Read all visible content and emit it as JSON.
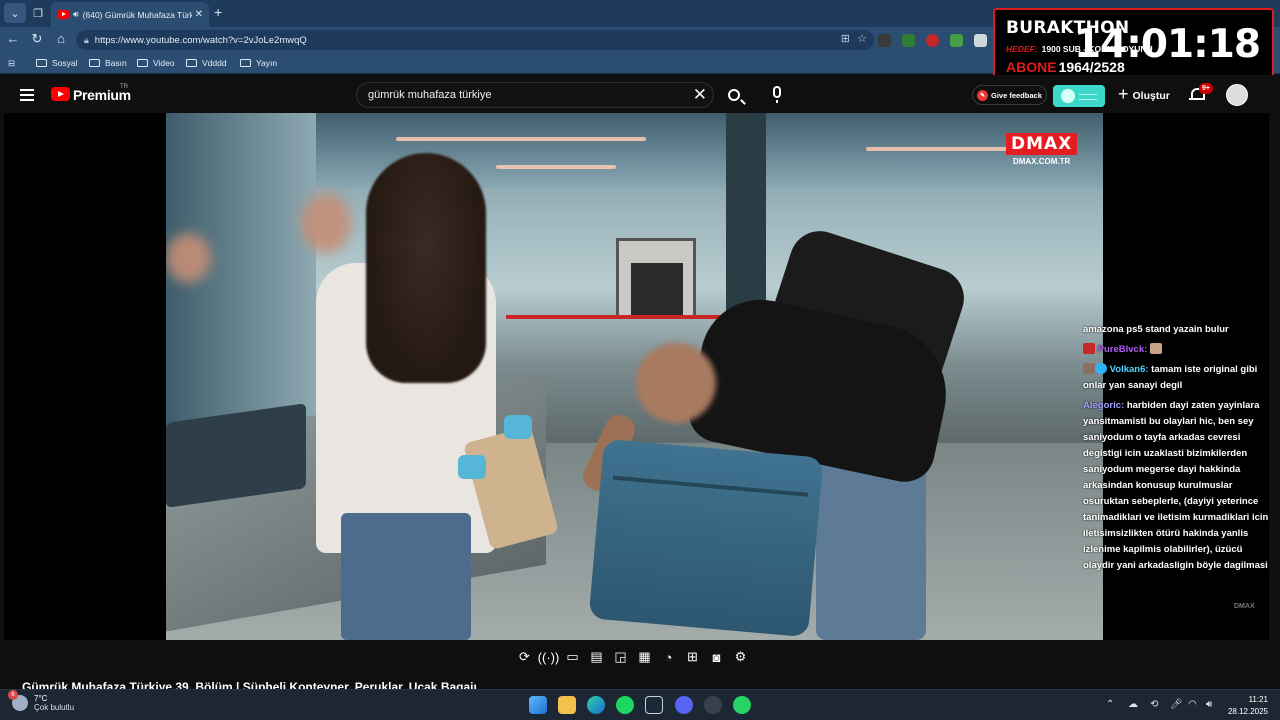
{
  "browser": {
    "tab_title": "(640) Gümrük Muhafaza Türkiye",
    "url": "https://www.youtube.com/watch?v=2vJoLe2mwqQ",
    "bookmarks": [
      "Sosyal",
      "Basın",
      "Video",
      "Vdddd",
      "Yayın"
    ]
  },
  "overlay": {
    "name": "BURAKTHON",
    "hedef_label": "HEDEF:",
    "hedef_text": "1900 SUB - KORKU OYUNU",
    "abone_label": "ABONE",
    "abone_value": "1964/2528",
    "clock": "14:01:18"
  },
  "youtube": {
    "logo_text": "Premium",
    "region": "TR",
    "search_value": "gümrük muhafaza türkiye",
    "feedback_label": "Give feedback",
    "create_label": "Oluştur",
    "notification_count": "9+"
  },
  "video": {
    "brand": "DMAX",
    "brand_domain": "DMAX.COM.TR",
    "watermark": "DMAX",
    "title": "Gümrük Muhafaza Türkiye 39. Bölüm | Şüpheli Konteyner, Peruklar, Uçak Bagajı"
  },
  "chat": [
    {
      "user": "",
      "text": "amazona ps5 stand yazain bulur",
      "color": "#ffffff"
    },
    {
      "user": "PureBlvck:",
      "text": "",
      "color": "#b15cf6",
      "emote": true
    },
    {
      "user": "Volkan6:",
      "text": "tamam iste original gibi onlar yan sanayi degil",
      "color": "#53d4ff"
    },
    {
      "user": "Alegoric:",
      "text": "harbiden dayi zaten yayinlara yansitmamisti bu olaylari hic, ben sey saniyodum o tayfa arkadas cevresi degistigi icin uzaklasti bizimkilerden saniyodum megerse dayi hakkinda arkasindan konusup kurulmuslar osuruktan sebeplerle, (dayiyi yeterince tanimadiklari ve iletisim kurmadiklari icin iletisimsizlikten ötürü hakinda yanlis izlenime kapilmis olabilirler), üzücü olaydir yani arkadasligin böyle dagilmasi",
      "color": "#9fa0ff"
    }
  ],
  "taskbar": {
    "temperature": "7°C",
    "weather": "Çok bulutlu",
    "weather_badge": "6",
    "time": "11:21",
    "date": "28.12.2025"
  },
  "colors": {
    "youtube_red": "#ff0000",
    "overlay_red": "#e01b1b",
    "browser_frame": "#2c4d72"
  }
}
